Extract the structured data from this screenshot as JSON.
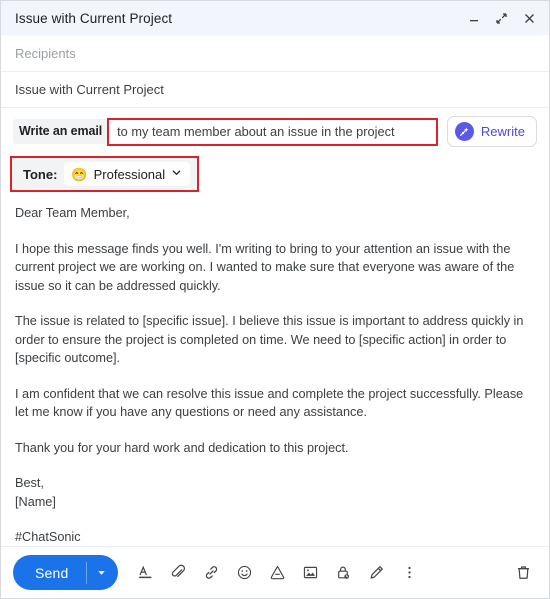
{
  "window": {
    "title": "Issue with Current Project",
    "controls": [
      {
        "name": "minimize",
        "icon": "minimize-icon"
      },
      {
        "name": "expand",
        "icon": "expand-icon"
      },
      {
        "name": "close",
        "icon": "close-icon"
      }
    ]
  },
  "fields": {
    "recipients_placeholder": "Recipients",
    "subject_value": "Issue with Current Project"
  },
  "ai_bar": {
    "chip_label": "Write an email",
    "prompt_value": "to my team member about an issue in the project",
    "rewrite_label": "Rewrite",
    "rewrite_icon": "magic-wand-icon",
    "accent_purple": "#5a5ae6",
    "highlight_color": "#d8232a"
  },
  "tone": {
    "label": "Tone:",
    "emoji": "😁",
    "value": "Professional",
    "chevron": "chevron-down-icon"
  },
  "body": {
    "greeting": "Dear Team Member,",
    "paragraph_1": "I hope this message finds you well. I'm writing to bring to your attention an issue with the current project we are working on. I wanted to make sure that everyone was aware of the issue so it can be addressed quickly.",
    "paragraph_2": "The issue is related to [specific issue]. I believe this issue is important to address quickly in order to ensure the project is completed on time. We need to [specific action] in order to [specific outcome].",
    "paragraph_3": "I am confident that we can resolve this issue and complete the project successfully. Please let me know if you have any questions or need any assistance.",
    "paragraph_4": "Thank you for your hard work and dedication to this project.",
    "signoff": "Best,",
    "signature_name": "[Name]",
    "hashtag": "#ChatSonic"
  },
  "footer": {
    "send_label": "Send",
    "send_caret": "caret-down-icon",
    "send_color": "#1a73e8",
    "tools": [
      {
        "name": "format-text-icon"
      },
      {
        "name": "attach-file-icon"
      },
      {
        "name": "insert-link-icon"
      },
      {
        "name": "insert-emoji-icon"
      },
      {
        "name": "insert-drive-icon"
      },
      {
        "name": "insert-photo-icon"
      },
      {
        "name": "confidential-mode-icon"
      },
      {
        "name": "insert-signature-icon"
      },
      {
        "name": "more-options-icon"
      }
    ],
    "trash": "delete-draft-icon"
  }
}
